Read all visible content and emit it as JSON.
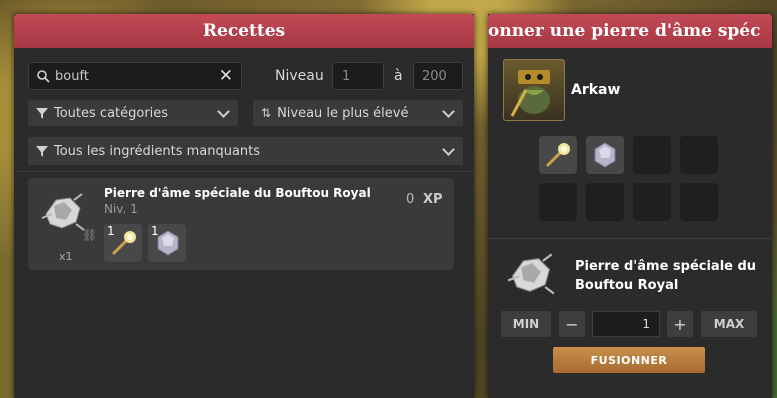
{
  "recipes": {
    "title": "Recettes",
    "search": {
      "value": "bouft"
    },
    "level_label": "Niveau",
    "level_min": "1",
    "to_label": "à",
    "level_max": "200",
    "category_filter": "Toutes catégories",
    "sort": "Niveau le plus élevé",
    "ingredients_filter": "Tous les ingrédients manquants",
    "item": {
      "name": "Pierre d'âme spéciale du Bouftou Royal",
      "level": "Niv. 1",
      "xp_value": "0",
      "xp_label": "XP",
      "multiplier": "x1",
      "ingredients": [
        {
          "qty": "1",
          "icon": "sceptre-icon"
        },
        {
          "qty": "1",
          "icon": "soul-stone-icon"
        }
      ]
    }
  },
  "fusion": {
    "title": "onner une pierre d'âme spéc",
    "character": "Arkaw",
    "result_line1": "Pierre d'âme spéciale du",
    "result_line2": "Bouftou Royal",
    "min_label": "MIN",
    "minus": "−",
    "quantity": "1",
    "plus": "+",
    "max_label": "MAX",
    "fuse_label": "FUSIONNER"
  },
  "colors": {
    "header": "#b3404c",
    "panel": "#2b2b2b",
    "fuse_button": "#b77a3c"
  }
}
